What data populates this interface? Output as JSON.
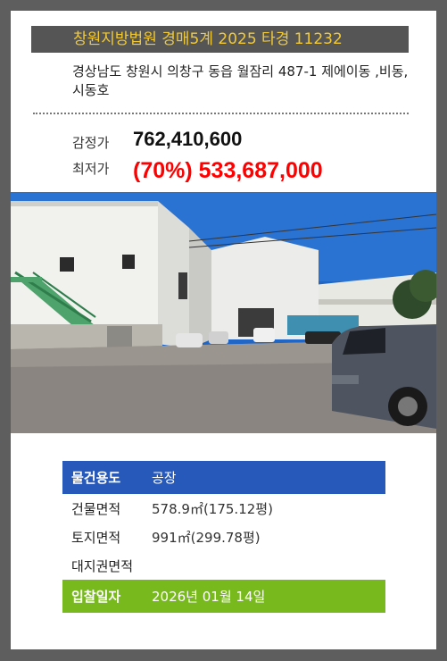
{
  "header": {
    "title": "창원지방법원 경매5계 2025 타경 11232"
  },
  "property": {
    "address": "경상남도 창원시 의창구 동읍 월잠리 487-1 제에이동 ,비동,시동호"
  },
  "prices": {
    "appraisal_label": "감정가",
    "appraisal_value": "762,410,600",
    "minimum_label": "최저가",
    "minimum_value": "(70%) 533,687,000"
  },
  "details": {
    "usage_label": "물건용도",
    "usage_value": "공장",
    "building_area_label": "건물면적",
    "building_area_value": "578.9㎡(175.12평)",
    "land_area_label": "토지면적",
    "land_area_value": "991㎡(299.78평)",
    "land_right_label": "대지권면적",
    "land_right_value": "",
    "bid_date_label": "입찰일자",
    "bid_date_value": "2026년 01월 14일"
  },
  "colors": {
    "background": "#5e5e5e",
    "header_bar": "#555555",
    "header_text": "#f2c933",
    "minimum_price": "#ff0000",
    "usage_row": "#2659b9",
    "bid_date_row": "#78b91d"
  }
}
